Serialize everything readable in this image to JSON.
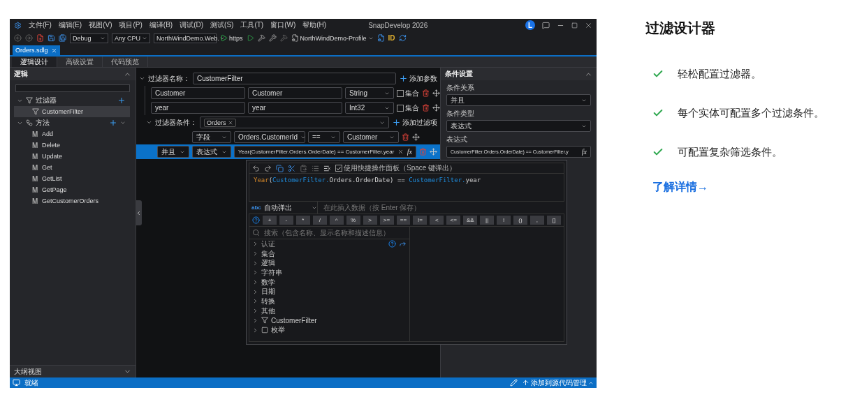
{
  "window": {
    "title": "SnapDevelop 2026",
    "avatar": "L"
  },
  "menu": [
    "文件(F)",
    "编辑(E)",
    "视图(V)",
    "项目(P)",
    "编译(B)",
    "调试(D)",
    "测试(S)",
    "工具(T)",
    "窗口(W)",
    "帮助(H)"
  ],
  "toolbar": {
    "configuration": "Debug",
    "platform": "Any CPU",
    "project": "NorthWindDemo.Web.",
    "run_target": "https",
    "profile": "NorthWindDemo-Profile",
    "id_label": "ID"
  },
  "document_tabs": [
    {
      "label": "Orders.sdlg",
      "selected": true
    }
  ],
  "sub_tabs": [
    {
      "label": "逻辑设计",
      "selected": true
    },
    {
      "label": "高级设置",
      "selected": false
    },
    {
      "label": "代码预览",
      "selected": false
    }
  ],
  "left_panel": {
    "title": "逻辑",
    "outline_title": "大纲视图",
    "tree": [
      {
        "label": "过滤器",
        "kind": "filters",
        "expanded": true,
        "children": [
          {
            "label": "CustomerFilter",
            "kind": "filter",
            "selected": true
          }
        ]
      },
      {
        "label": "方法",
        "kind": "methods",
        "expanded": true,
        "children": [
          {
            "label": "Add",
            "kind": "method",
            "icon": "M",
            "selected": false
          },
          {
            "label": "Delete",
            "kind": "method",
            "icon": "M",
            "selected": false
          },
          {
            "label": "Update",
            "kind": "method",
            "icon": "M",
            "selected": false
          },
          {
            "label": "Get",
            "kind": "method",
            "icon": "M",
            "selected": false
          },
          {
            "label": "GetList",
            "kind": "method",
            "icon": "M",
            "selected": false
          },
          {
            "label": "GetPage",
            "kind": "method",
            "icon": "M",
            "selected": false
          },
          {
            "label": "GetCustomerOrders",
            "kind": "method",
            "icon": "M",
            "selected": false
          }
        ]
      }
    ]
  },
  "filter": {
    "name_label": "过滤器名称：",
    "name": "CustomerFilter",
    "add_param": "添加参数",
    "params": [
      {
        "name": "Customer",
        "display": "Customer",
        "type": "String",
        "collection_label": "集合",
        "collection": false
      },
      {
        "name": "year",
        "display": "year",
        "type": "Int32",
        "collection_label": "集合",
        "collection": false
      }
    ],
    "conditions_label": "过滤器条件：",
    "entities": [
      "Orders"
    ],
    "add_condition": "添加过滤项",
    "conditions": [
      {
        "kind": "field",
        "type": "字段",
        "field": "Orders.CustomerId",
        "operator": "==",
        "value": "Customer",
        "selected": false
      },
      {
        "kind": "expression",
        "relation": "并且",
        "type": "表达式",
        "expression": "Year(CustomerFilter.Orders.OrderDate) == CustomerFilter.year",
        "function_button": "fx",
        "selected": true
      }
    ]
  },
  "condition_settings": {
    "title": "条件设置",
    "fields": [
      {
        "label": "条件关系",
        "value": "并且",
        "kind": "select"
      },
      {
        "label": "条件类型",
        "value": "表达式",
        "kind": "select"
      },
      {
        "label": "表达式",
        "value": "CustomerFilter.Orders.OrderDate) == CustomerFilter.y",
        "kind": "expression",
        "function_button": "fx"
      }
    ]
  },
  "expression_editor": {
    "quick_panel_label": "使用快捷操作面板（Space 键弹出）",
    "quick_panel": true,
    "code": [
      {
        "text": "Year",
        "kind": "function"
      },
      {
        "text": "(",
        "kind": "plain"
      },
      {
        "text": "CustomerFilter.",
        "kind": "object"
      },
      {
        "text": "Orders.OrderDate) == ",
        "kind": "plain"
      },
      {
        "text": "CustomerFilter.",
        "kind": "object"
      },
      {
        "text": "year",
        "kind": "plain"
      }
    ],
    "mode_icon": "abc",
    "mode": "自动弹出",
    "input_placeholder": "在此插入数据（按 Enter 保存）",
    "operators": [
      "+",
      "-",
      "*",
      "/",
      "^",
      "%",
      ">",
      ">=",
      "==",
      "!=",
      "<",
      "<=",
      "&&",
      "||",
      "!",
      "()",
      ",",
      "[]"
    ],
    "search_placeholder": "搜索（包含名称、显示名称和描述信息）",
    "categories": [
      {
        "label": "认证",
        "kind": "folder"
      },
      {
        "label": "集合",
        "kind": "folder"
      },
      {
        "label": "逻辑",
        "kind": "folder"
      },
      {
        "label": "字符串",
        "kind": "folder"
      },
      {
        "label": "数学",
        "kind": "folder"
      },
      {
        "label": "日期",
        "kind": "folder"
      },
      {
        "label": "转换",
        "kind": "folder"
      },
      {
        "label": "其他",
        "kind": "folder"
      },
      {
        "label": "CustomerFilter",
        "kind": "filter"
      },
      {
        "label": "枚举",
        "kind": "enum"
      }
    ]
  },
  "status_bar": {
    "status": "就绪",
    "source_control": "添加到源代码管理"
  },
  "promo": {
    "title": "过滤设计器",
    "bullets": [
      "轻松配置过滤器。",
      "每个实体可配置多个过滤条件。",
      "可配置复杂筛选条件。"
    ],
    "link": "了解详情→"
  }
}
